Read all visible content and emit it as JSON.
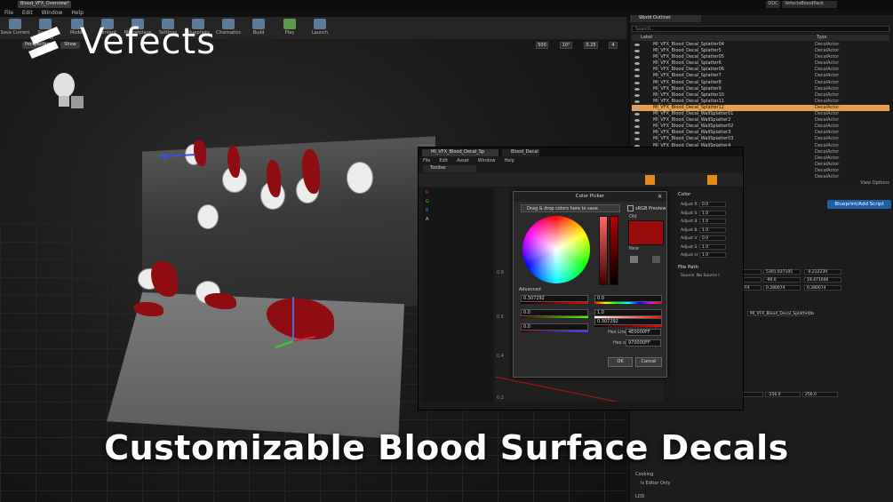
{
  "window": {
    "tab_title": "Blood_VFX_Overview*",
    "project_name": "VefectsBloodPack",
    "ddc_label": "DDC"
  },
  "menu": [
    "File",
    "Edit",
    "Window",
    "Help"
  ],
  "toolbar": [
    {
      "label": "Save Current"
    },
    {
      "label": "Source Control"
    },
    {
      "label": "Modes"
    },
    {
      "label": "Content"
    },
    {
      "label": "Marketplace"
    },
    {
      "label": "Settings"
    },
    {
      "label": "Blueprints"
    },
    {
      "label": "Cinematics"
    },
    {
      "label": "Build"
    },
    {
      "label": "Play"
    },
    {
      "label": "Launch"
    }
  ],
  "viewport": {
    "view_mode": "Perspective",
    "show_label": "Show",
    "snap_values": [
      "500",
      "10°",
      "0.25",
      "4"
    ]
  },
  "logo_text": "Vefects",
  "caption": "Customizable Blood Surface Decals",
  "outliner": {
    "title": "World Outliner",
    "search_placeholder": "Search...",
    "col_label": "Label",
    "col_type": "Type",
    "rows": [
      {
        "label": "MI_VFX_Blood_Decal_Splatter04",
        "type": "DecalActor"
      },
      {
        "label": "MI_VFX_Blood_Decal_Splatter5",
        "type": "DecalActor"
      },
      {
        "label": "MI_VFX_Blood_Decal_Splatter05",
        "type": "DecalActor"
      },
      {
        "label": "MI_VFX_Blood_Decal_Splatter6",
        "type": "DecalActor"
      },
      {
        "label": "MI_VFX_Blood_Decal_Splatter06",
        "type": "DecalActor"
      },
      {
        "label": "MI_VFX_Blood_Decal_Splatter7",
        "type": "DecalActor"
      },
      {
        "label": "MI_VFX_Blood_Decal_Splatter8",
        "type": "DecalActor"
      },
      {
        "label": "MI_VFX_Blood_Decal_Splatter9",
        "type": "DecalActor"
      },
      {
        "label": "MI_VFX_Blood_Decal_Splatter10",
        "type": "DecalActor"
      },
      {
        "label": "MI_VFX_Blood_Decal_Splatter11",
        "type": "DecalActor"
      },
      {
        "label": "MI_VFX_Blood_Decal_Splatter12",
        "type": "DecalActor",
        "selected": true
      },
      {
        "label": "MI_VFX_Blood_Decal_WallSplatter01",
        "type": "DecalActor"
      },
      {
        "label": "MI_VFX_Blood_Decal_WallSplatter2",
        "type": "DecalActor"
      },
      {
        "label": "MI_VFX_Blood_Decal_WallSplatter02",
        "type": "DecalActor"
      },
      {
        "label": "MI_VFX_Blood_Decal_WallSplatter3",
        "type": "DecalActor"
      },
      {
        "label": "MI_VFX_Blood_Decal_WallSplatter03",
        "type": "DecalActor"
      },
      {
        "label": "MI_VFX_Blood_Decal_WallSplatter4",
        "type": "DecalActor"
      },
      {
        "label": "MI_VFX_Blood_Decal_WallSplatter04",
        "type": "DecalActor"
      },
      {
        "label": "MI_VFX_Blood_Decal_WallSplatter5",
        "type": "DecalActor"
      },
      {
        "label": "MI_VFX_Blood_Decal_WallSplatter05",
        "type": "DecalActor"
      },
      {
        "label": "MI_VFX_Blood_Decal_WallSplatter6",
        "type": "DecalActor"
      },
      {
        "label": "MI_VFX_Blood_Decal_WallSplatter06",
        "type": "DecalActor"
      }
    ],
    "view_options": "View Options"
  },
  "details": {
    "blueprint_button": "Blueprint/Add Script",
    "location": [
      "3146",
      "5301.037105",
      "-0.232239"
    ],
    "rotation": [
      "-90.0",
      "-90.0",
      "19.471046"
    ],
    "scale": [
      "0.280074",
      "0.280074",
      "0.280074"
    ],
    "material_name": "MI_VFX_Blood_Decal_Splatter0b",
    "decal_size": [
      "-256.0",
      "-256.0",
      "256.0"
    ],
    "cooking_section": "Cooking",
    "cooking_prop": "Is Editor Only",
    "lod_section": "LOD"
  },
  "material_editor": {
    "tabs": [
      "MI_VFX_Blood_Decal_Sp",
      "Blood_Decal"
    ],
    "menu": [
      "File",
      "Edit",
      "Asset",
      "Window",
      "Help"
    ],
    "toolbar_tab": "Toolbar",
    "channels": [
      "R",
      "G",
      "B",
      "A"
    ],
    "graph_axis": [
      "0.8",
      "0.6",
      "0.4",
      "0.2"
    ],
    "right": {
      "section": "Color",
      "rows": [
        {
          "label": "Adjust R",
          "value": "0.0"
        },
        {
          "label": "Adjust S",
          "value": "1.0"
        },
        {
          "label": "Adjust B",
          "value": "1.0"
        },
        {
          "label": "Adjust B",
          "value": "1.0"
        },
        {
          "label": "Adjust V",
          "value": "0.0"
        },
        {
          "label": "Adjust S",
          "value": "1.0"
        },
        {
          "label": "Adjust H",
          "value": "1.0"
        }
      ],
      "file_section": "File Path",
      "source_label": "Source",
      "source_value": "No Source I"
    }
  },
  "color_picker": {
    "title": "Color Picker",
    "drag_text": "Drag & drop colors here to save",
    "srgb_label": "sRGB Preview",
    "old_label": "Old",
    "new_label": "New",
    "advanced_label": "Advanced",
    "fields": {
      "r": "0.307292",
      "g": "0.0",
      "b": "0.0",
      "h": "0.0",
      "s": "1.0",
      "v": "0.307292"
    },
    "hex_linear_label": "Hex Linear",
    "hex_linear": "4E0000FF",
    "hex_srgb_label": "Hex sRGB",
    "hex_srgb": "970000FF",
    "ok_label": "OK",
    "cancel_label": "Cancel",
    "current_color": "#9a0b0b"
  }
}
